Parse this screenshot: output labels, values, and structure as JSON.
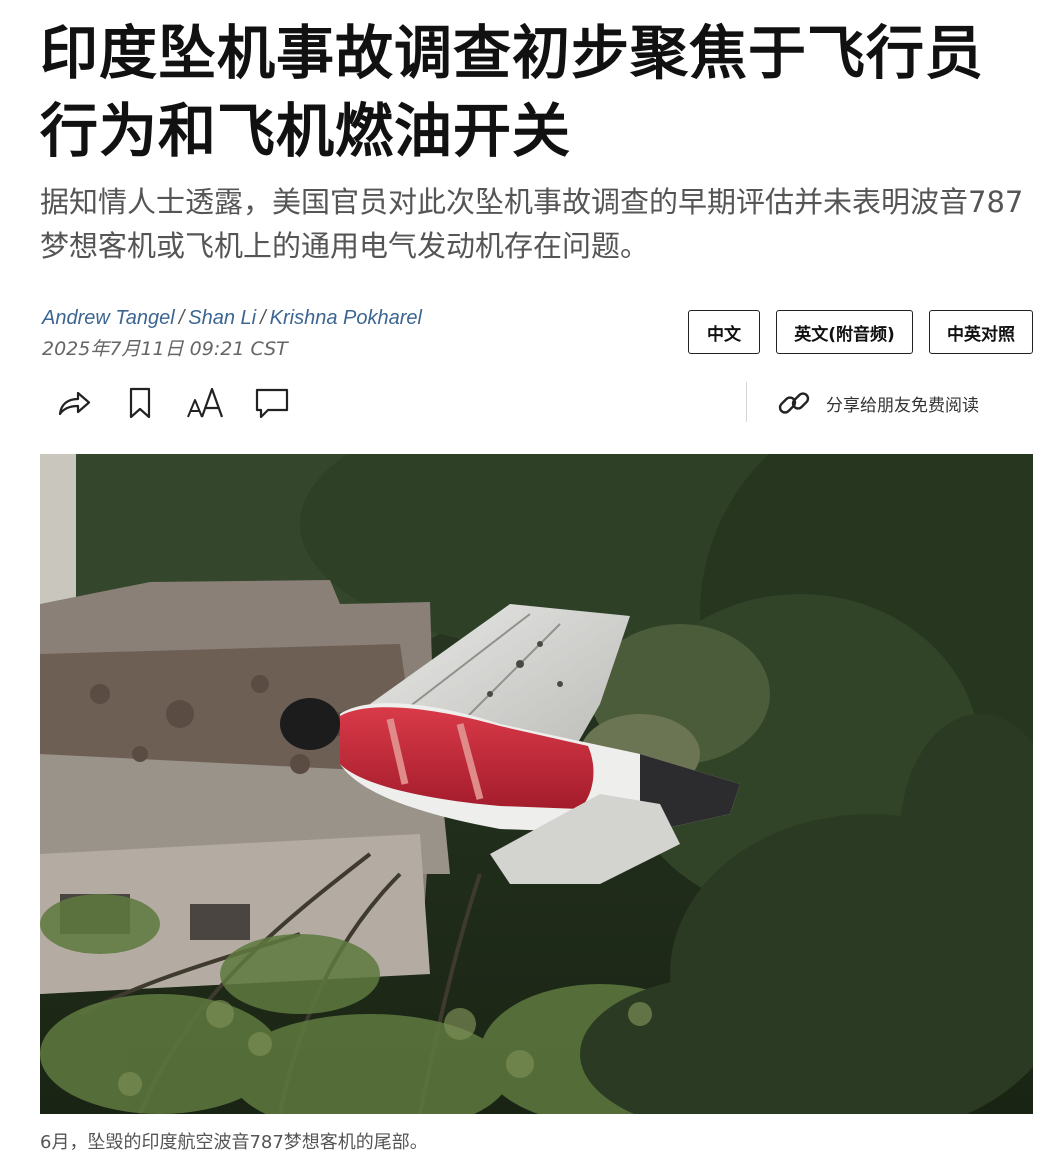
{
  "article": {
    "headline": "印度坠机事故调查初步聚焦于飞行员行为和飞机燃油开关",
    "dek": "据知情人士透露，美国官员对此次坠机事故调查的早期评估并未表明波音787梦想客机或飞机上的通用电气发动机存在问题。",
    "authors": [
      "Andrew Tangel",
      "Shan Li",
      "Krishna Pokharel"
    ],
    "author_separator": "/",
    "timestamp": "2025年7月11日 09:21 CST"
  },
  "language_buttons": [
    "中文",
    "英文(附音频)",
    "中英对照"
  ],
  "toolbar": {
    "icons": [
      "share-icon",
      "bookmark-icon",
      "font-size-icon",
      "comment-icon"
    ],
    "share_gift_label": "分享给朋友免费阅读",
    "share_gift_icon": "link-icon"
  },
  "photo": {
    "caption": "6月，坠毁的印度航空波音787梦想客机的尾部。"
  },
  "colors": {
    "author_link": "#3c6591",
    "headline": "#111111",
    "dek": "#555555",
    "tail_red": "#c8263a"
  }
}
